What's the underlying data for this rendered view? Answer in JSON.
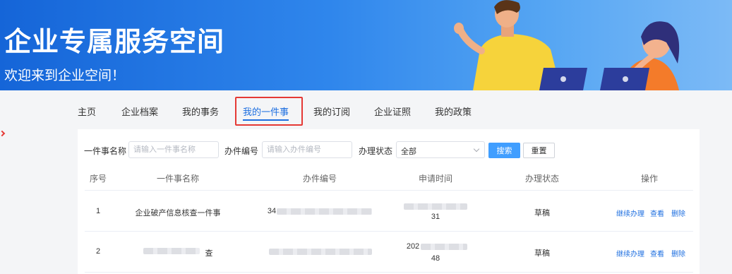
{
  "banner": {
    "title": "企业专属服务空间",
    "subtitle": "欢迎来到企业空间！"
  },
  "nav": {
    "items": [
      "主页",
      "企业档案",
      "我的事务",
      "我的一件事",
      "我的订阅",
      "企业证照",
      "我的政策"
    ],
    "active": "我的一件事"
  },
  "filters": {
    "name_label": "一件事名称",
    "name_placeholder": "请输入一件事名称",
    "number_label": "办件编号",
    "number_placeholder": "请输入办件编号",
    "status_label": "办理状态",
    "status_value": "全部",
    "search_button": "搜索",
    "reset_button": "重置"
  },
  "table": {
    "headers": [
      "序号",
      "一件事名称",
      "办件编号",
      "申请时间",
      "办理状态",
      "操作"
    ],
    "rows": [
      {
        "index": "1",
        "name": "企业破产信息核查一件事",
        "number": "34",
        "time_top": "",
        "time_bottom": "31",
        "status": "草稿",
        "actions": [
          "继续办理",
          "查看",
          "删除"
        ]
      },
      {
        "index": "2",
        "name": "查",
        "number": "",
        "time_top": "202",
        "time_bottom": "48",
        "status": "草稿",
        "actions": [
          "继续办理",
          "查看",
          "删除"
        ]
      }
    ]
  },
  "colors": {
    "banner_start": "#1565d8",
    "banner_end": "#7cbaf6",
    "accent": "#1e6fe0",
    "button_primary": "#409eff",
    "highlight": "#e53935"
  }
}
